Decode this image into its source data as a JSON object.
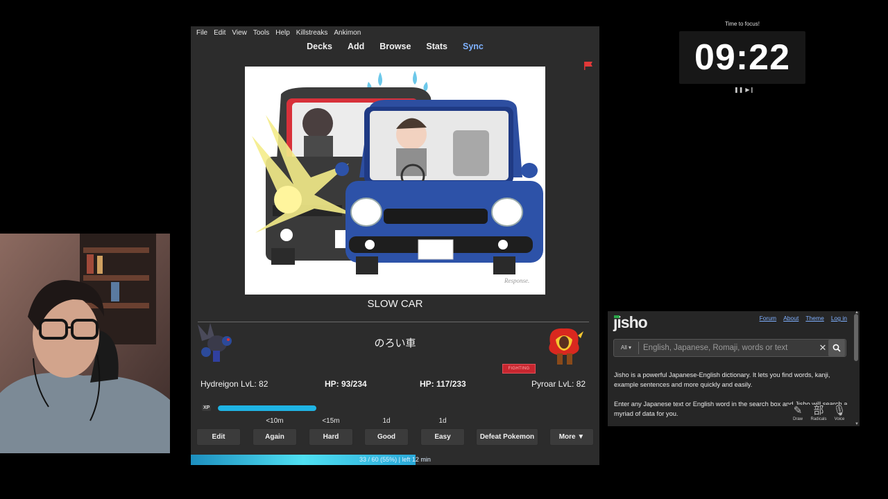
{
  "anki": {
    "menu": [
      "File",
      "Edit",
      "View",
      "Tools",
      "Help",
      "Killstreaks",
      "Ankimon"
    ],
    "toolbar": {
      "decks": "Decks",
      "add": "Add",
      "browse": "Browse",
      "stats": "Stats",
      "sync": "Sync"
    },
    "card": {
      "front": "SLOW CAR",
      "back": "のろい車",
      "image_watermark": "Response."
    },
    "battle": {
      "player_name": "Hydreigon LvL: 82",
      "player_hp": "HP: 93/234",
      "enemy_hp": "HP: 117/233",
      "enemy_name": "Pyroar LvL: 82",
      "enemy_type": "FIGHTING",
      "xp_label": "XP",
      "xp_fraction": 0.49
    },
    "intervals": {
      "again": "<10m",
      "hard": "<15m",
      "good": "1d",
      "easy": "1d"
    },
    "buttons": {
      "edit": "Edit",
      "again": "Again",
      "hard": "Hard",
      "good": "Good",
      "easy": "Easy",
      "defeat": "Defeat Pokemon",
      "more": "More ▼"
    },
    "progress": {
      "text": "33 / 60 (55%) | left 12 min",
      "fraction": 0.55
    }
  },
  "timer": {
    "label": "Time to focus!",
    "value": "09:22"
  },
  "jisho": {
    "logo": "jisho",
    "nav": [
      "Forum",
      "About",
      "Theme",
      "Log in"
    ],
    "scope": "All ▾",
    "search_placeholder": "English, Japanese, Romaji, words or text",
    "intro1": "Jisho is a powerful Japanese-English dictionary. It lets you find words, kanji, example sentences and more quickly and easily.",
    "intro2": "Enter any Japanese text or English word in the search box and Jisho will search a myriad of data for you.",
    "tools": {
      "draw": "Draw",
      "radicals": "Radicals",
      "voice": "Voice",
      "radicals_glyph": "部"
    }
  },
  "colors": {
    "anki_bg": "#2c2c2c",
    "xp_bar": "#1fb4e4",
    "sync_link": "#7fb2ff",
    "type_badge": "#c8262f",
    "jisho_link": "#7fb0ff"
  }
}
